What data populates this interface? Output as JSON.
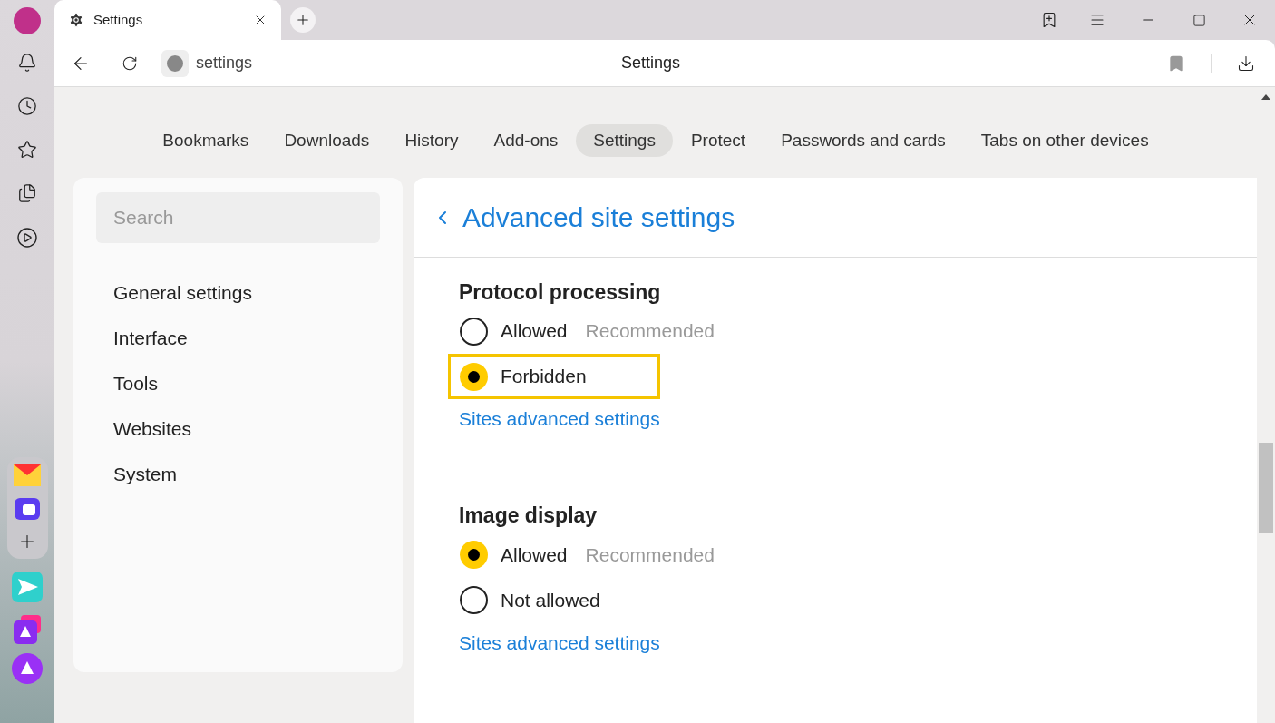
{
  "browser_tab": {
    "title": "Settings"
  },
  "address_bar": {
    "url": "settings",
    "page_title": "Settings"
  },
  "nav_tabs": [
    {
      "label": "Bookmarks",
      "selected": false
    },
    {
      "label": "Downloads",
      "selected": false
    },
    {
      "label": "History",
      "selected": false
    },
    {
      "label": "Add-ons",
      "selected": false
    },
    {
      "label": "Settings",
      "selected": true
    },
    {
      "label": "Protect",
      "selected": false
    },
    {
      "label": "Passwords and cards",
      "selected": false
    },
    {
      "label": "Tabs on other devices",
      "selected": false
    }
  ],
  "sidebar": {
    "search": {
      "placeholder": "Search"
    },
    "items": [
      "General settings",
      "Interface",
      "Tools",
      "Websites",
      "System"
    ]
  },
  "panel": {
    "title": "Advanced site settings",
    "sections": [
      {
        "heading": "Protocol processing",
        "options": [
          {
            "label": "Allowed",
            "note": "Recommended",
            "selected": false,
            "highlighted": false
          },
          {
            "label": "Forbidden",
            "selected": true,
            "highlighted": true
          }
        ],
        "link": "Sites advanced settings"
      },
      {
        "heading": "Image display",
        "options": [
          {
            "label": "Allowed",
            "note": "Recommended",
            "selected": true,
            "highlighted": false
          },
          {
            "label": "Not allowed",
            "selected": false,
            "highlighted": false
          }
        ],
        "link": "Sites advanced settings"
      }
    ]
  }
}
